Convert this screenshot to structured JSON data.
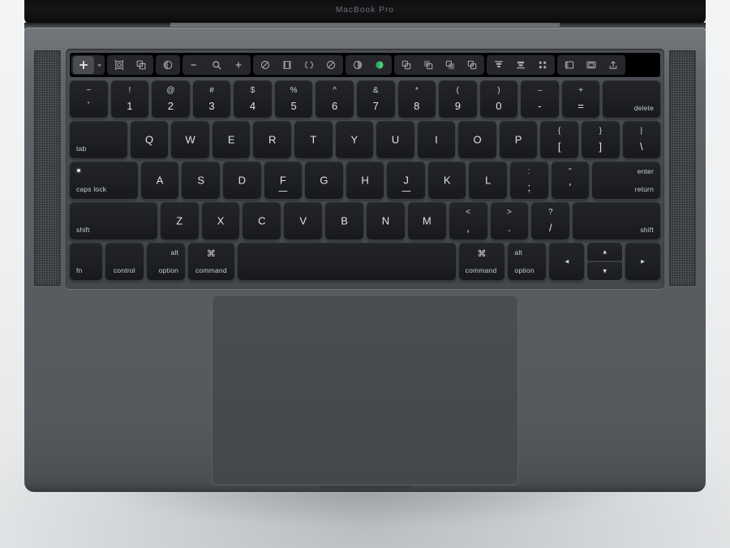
{
  "device": {
    "lid_logo": "MacBook Pro"
  },
  "touchbar": {
    "groups": [
      {
        "name": "insert-group",
        "buttons": [
          {
            "name": "add-button",
            "icon": "plus-icon",
            "filled": true
          },
          {
            "name": "add-dropdown-caret",
            "icon": "chevron-down-icon",
            "caret": true
          }
        ]
      },
      {
        "name": "selection-group",
        "buttons": [
          {
            "name": "select-frame-button",
            "icon": "select-frame-icon"
          },
          {
            "name": "select-object-button",
            "icon": "select-object-icon"
          }
        ]
      },
      {
        "name": "appearance-group",
        "buttons": [
          {
            "name": "shading-button",
            "icon": "shaded-sphere-icon"
          }
        ]
      },
      {
        "name": "zoom-group",
        "buttons": [
          {
            "name": "zoom-out-button",
            "icon": "minus-icon"
          },
          {
            "name": "zoom-magnifier-button",
            "icon": "magnifier-icon"
          },
          {
            "name": "zoom-in-button",
            "icon": "plus-small-icon"
          }
        ]
      },
      {
        "name": "transform-group",
        "buttons": [
          {
            "name": "bevel-button",
            "icon": "bevel-sphere-icon"
          },
          {
            "name": "deform-button",
            "icon": "deform-cage-icon"
          },
          {
            "name": "rotate-button",
            "icon": "rotate-arc-icon"
          },
          {
            "name": "smooth-button",
            "icon": "smooth-sphere-icon"
          }
        ]
      },
      {
        "name": "material-group",
        "buttons": [
          {
            "name": "material-preview-button",
            "icon": "material-sphere-icon"
          },
          {
            "name": "material-active-button",
            "icon": "material-active-icon",
            "accent": true
          }
        ]
      },
      {
        "name": "boolean-group",
        "buttons": [
          {
            "name": "boolean-union-button",
            "icon": "shape-union-icon"
          },
          {
            "name": "boolean-subtract-button",
            "icon": "shape-subtract-icon"
          },
          {
            "name": "boolean-intersect-button",
            "icon": "shape-intersect-icon"
          },
          {
            "name": "boolean-exclude-button",
            "icon": "shape-exclude-icon"
          }
        ]
      },
      {
        "name": "align-group",
        "buttons": [
          {
            "name": "align-top-button",
            "icon": "align-top-icon"
          },
          {
            "name": "align-bottom-button",
            "icon": "align-bottom-icon"
          },
          {
            "name": "distribute-button",
            "icon": "distribute-grid-icon"
          }
        ]
      },
      {
        "name": "panel-group",
        "buttons": [
          {
            "name": "toggle-left-panel-button",
            "icon": "panel-left-icon"
          },
          {
            "name": "toggle-right-panel-button",
            "icon": "panel-right-icon"
          },
          {
            "name": "share-button",
            "icon": "share-upload-icon"
          }
        ]
      }
    ],
    "accent_color": "#4cd07a"
  },
  "keyboard": {
    "rows": [
      {
        "name": "number-row",
        "keys": [
          {
            "name": "key-backtick",
            "upper": "~",
            "lower": "`"
          },
          {
            "name": "key-1",
            "upper": "!",
            "lower": "1"
          },
          {
            "name": "key-2",
            "upper": "@",
            "lower": "2"
          },
          {
            "name": "key-3",
            "upper": "#",
            "lower": "3"
          },
          {
            "name": "key-4",
            "upper": "$",
            "lower": "4"
          },
          {
            "name": "key-5",
            "upper": "%",
            "lower": "5"
          },
          {
            "name": "key-6",
            "upper": "^",
            "lower": "6"
          },
          {
            "name": "key-7",
            "upper": "&",
            "lower": "7"
          },
          {
            "name": "key-8",
            "upper": "*",
            "lower": "8"
          },
          {
            "name": "key-9",
            "upper": "(",
            "lower": "9"
          },
          {
            "name": "key-0",
            "upper": ")",
            "lower": "0"
          },
          {
            "name": "key-minus",
            "upper": "–",
            "lower": "-"
          },
          {
            "name": "key-equals",
            "upper": "+",
            "lower": "="
          },
          {
            "name": "key-delete",
            "word": "delete",
            "align": "br",
            "width": "w-delete"
          }
        ]
      },
      {
        "name": "top-letter-row",
        "keys": [
          {
            "name": "key-tab",
            "word": "tab",
            "align": "bl",
            "width": "w-tab"
          },
          {
            "name": "key-q",
            "glyph": "Q"
          },
          {
            "name": "key-w",
            "glyph": "W"
          },
          {
            "name": "key-e",
            "glyph": "E"
          },
          {
            "name": "key-r",
            "glyph": "R"
          },
          {
            "name": "key-t",
            "glyph": "T"
          },
          {
            "name": "key-y",
            "glyph": "Y"
          },
          {
            "name": "key-u",
            "glyph": "U"
          },
          {
            "name": "key-i",
            "glyph": "I"
          },
          {
            "name": "key-o",
            "glyph": "O"
          },
          {
            "name": "key-p",
            "glyph": "P"
          },
          {
            "name": "key-bracket-left",
            "upper": "{",
            "lower": "["
          },
          {
            "name": "key-bracket-right",
            "upper": "}",
            "lower": "]"
          },
          {
            "name": "key-backslash",
            "upper": "|",
            "lower": "\\"
          }
        ]
      },
      {
        "name": "home-row",
        "keys": [
          {
            "name": "key-caps-lock",
            "word": "caps lock",
            "align": "bl",
            "width": "w-caps",
            "indicator": true
          },
          {
            "name": "key-a",
            "glyph": "A"
          },
          {
            "name": "key-s",
            "glyph": "S"
          },
          {
            "name": "key-d",
            "glyph": "D"
          },
          {
            "name": "key-f",
            "glyph": "F",
            "homing": true
          },
          {
            "name": "key-g",
            "glyph": "G"
          },
          {
            "name": "key-h",
            "glyph": "H"
          },
          {
            "name": "key-j",
            "glyph": "J",
            "homing": true
          },
          {
            "name": "key-k",
            "glyph": "K"
          },
          {
            "name": "key-l",
            "glyph": "L"
          },
          {
            "name": "key-semicolon",
            "upper": ":",
            "lower": ";"
          },
          {
            "name": "key-quote",
            "upper": "\"",
            "lower": "'"
          },
          {
            "name": "key-return",
            "word_top": "enter",
            "word_bottom": "return",
            "align": "br",
            "width": "w-return"
          }
        ]
      },
      {
        "name": "bottom-letter-row",
        "keys": [
          {
            "name": "key-shift-left",
            "word": "shift",
            "align": "bl",
            "width": "w-shiftL"
          },
          {
            "name": "key-z",
            "glyph": "Z"
          },
          {
            "name": "key-x",
            "glyph": "X"
          },
          {
            "name": "key-c",
            "glyph": "C"
          },
          {
            "name": "key-v",
            "glyph": "V"
          },
          {
            "name": "key-b",
            "glyph": "B"
          },
          {
            "name": "key-n",
            "glyph": "N"
          },
          {
            "name": "key-m",
            "glyph": "M"
          },
          {
            "name": "key-comma",
            "upper": "<",
            "lower": ","
          },
          {
            "name": "key-period",
            "upper": ">",
            "lower": "."
          },
          {
            "name": "key-slash",
            "upper": "?",
            "lower": "/"
          },
          {
            "name": "key-shift-right",
            "word": "shift",
            "align": "br",
            "width": "w-shiftR"
          }
        ]
      },
      {
        "name": "modifier-row",
        "keys": [
          {
            "name": "key-fn",
            "word": "fn",
            "align": "bl",
            "width": "w-fn"
          },
          {
            "name": "key-control",
            "word": "control",
            "align": "bc",
            "width": "w-ctrl"
          },
          {
            "name": "key-option-left",
            "word_top": "alt",
            "word_bottom": "option",
            "align": "br",
            "width": "w-opt"
          },
          {
            "name": "key-command-left",
            "cmd_glyph": "⌘",
            "word_bottom": "command",
            "align": "bc",
            "width": "w-cmd"
          },
          {
            "name": "key-space",
            "width": "w-space"
          },
          {
            "name": "key-command-right",
            "cmd_glyph": "⌘",
            "word_bottom": "command",
            "align": "bl-cmd",
            "width": "w-cmd"
          },
          {
            "name": "key-option-right",
            "word_top": "alt",
            "word_bottom": "option",
            "align": "bl",
            "width": "w-opt"
          },
          {
            "name": "key-arrow-left",
            "arrow": "◄",
            "width": "w-arrow"
          },
          {
            "name": "key-arrow-updown",
            "arrow_up": "▲",
            "arrow_down": "▼",
            "split": true,
            "width": "w-arrow"
          },
          {
            "name": "key-arrow-right",
            "arrow": "►",
            "width": "w-arrow"
          }
        ]
      }
    ]
  }
}
